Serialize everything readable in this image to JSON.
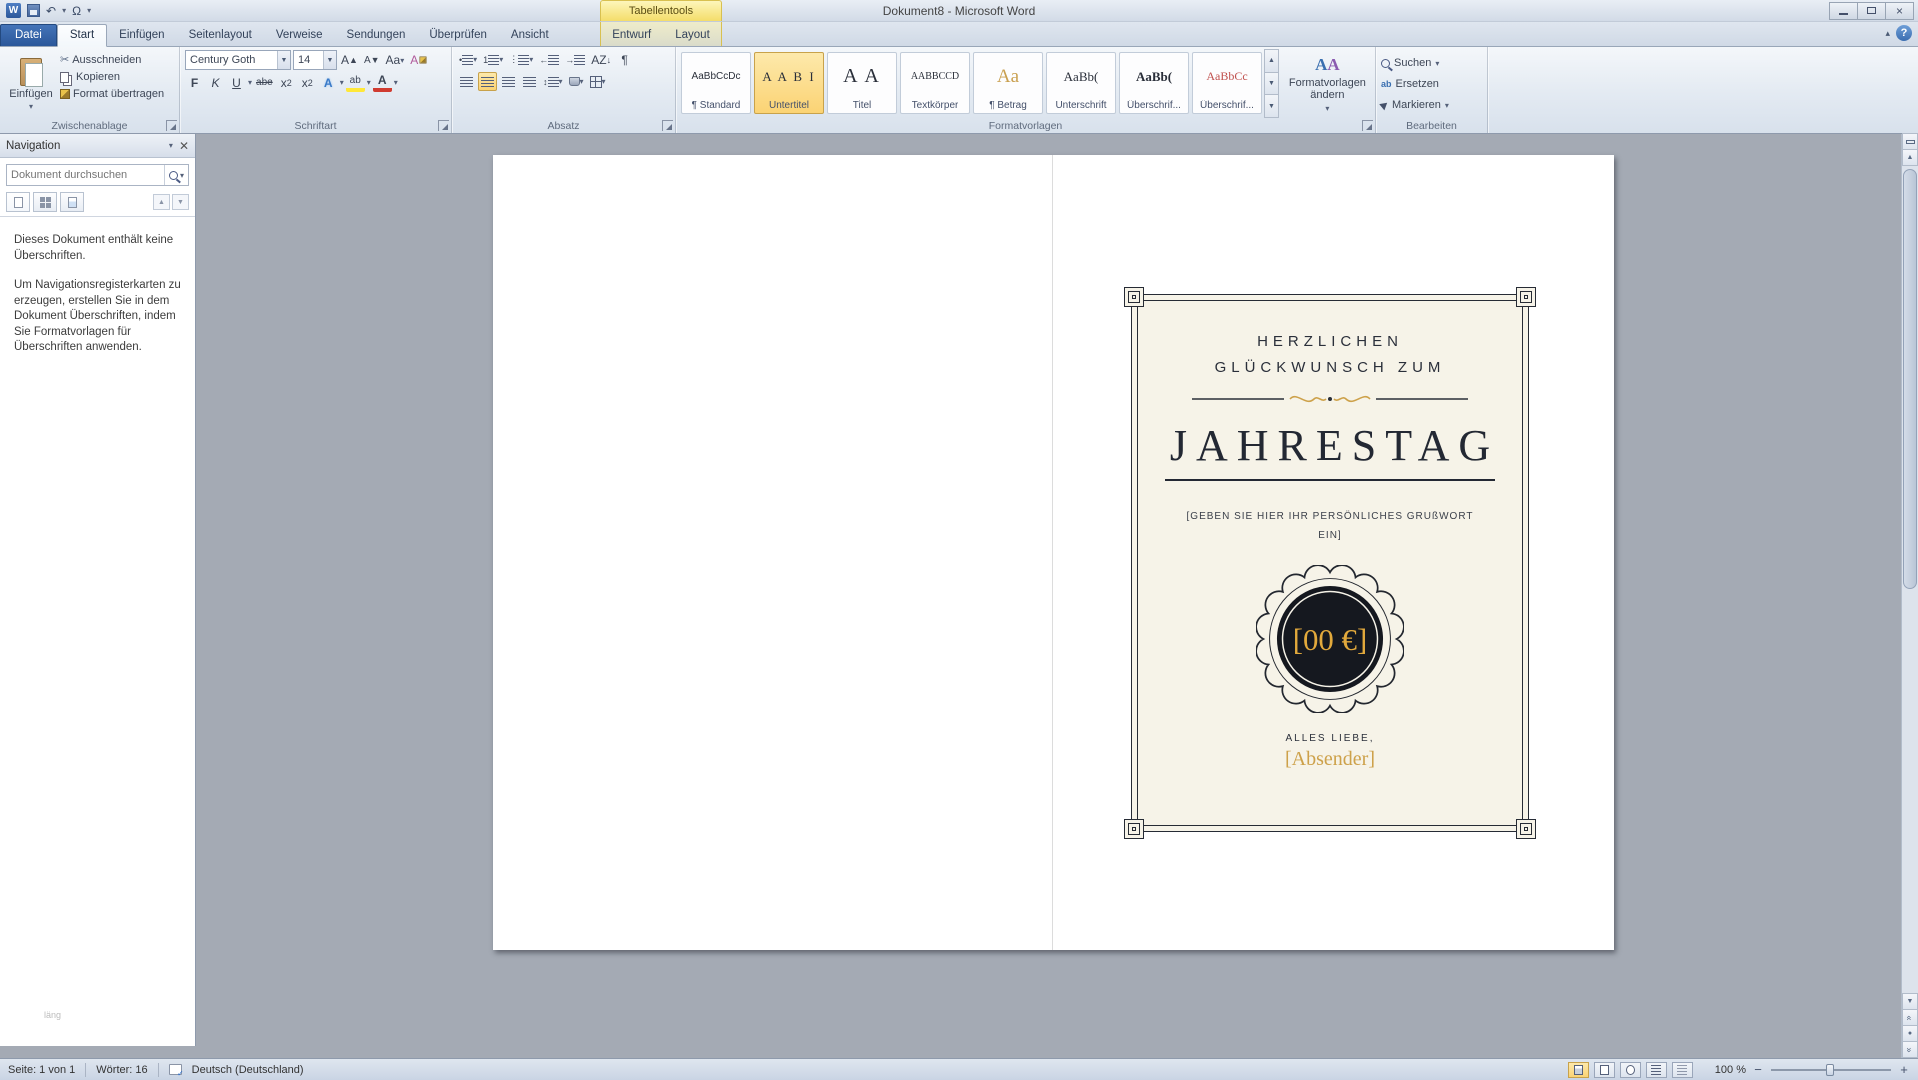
{
  "titlebar": {
    "title": "Dokument8 - Microsoft Word",
    "contextual_group": "Tabellentools"
  },
  "tabs": {
    "file": "Datei",
    "items": [
      "Start",
      "Einfügen",
      "Seitenlayout",
      "Verweise",
      "Sendungen",
      "Überprüfen",
      "Ansicht"
    ],
    "contextual": [
      "Entwurf",
      "Layout"
    ]
  },
  "ribbon": {
    "clipboard": {
      "group": "Zwischenablage",
      "paste": "Einfügen",
      "cut": "Ausschneiden",
      "copy": "Kopieren",
      "format_painter": "Format übertragen"
    },
    "font": {
      "group": "Schriftart",
      "font_name": "Century Goth",
      "font_size": "14",
      "bold": "F",
      "italic": "K",
      "underline": "U",
      "strike": "abe",
      "case": "Aa",
      "effects": "A",
      "highlight": "ab",
      "color": "A"
    },
    "paragraph": {
      "group": "Absatz",
      "sort": "AZ",
      "pilcrow": "¶"
    },
    "styles": {
      "group": "Formatvorlagen",
      "change_styles": "Formatvorlagen ändern",
      "items": [
        {
          "preview": "AaBbCcDc",
          "label": "¶ Standard"
        },
        {
          "preview": "A A B I",
          "label": "Untertitel"
        },
        {
          "preview": "A A",
          "label": "Titel"
        },
        {
          "preview": "AABBCCD",
          "label": "Textkörper"
        },
        {
          "preview": "Aa",
          "label": "¶ Betrag"
        },
        {
          "preview": "AaBb(",
          "label": "Unterschrift"
        },
        {
          "preview": "AaBb(",
          "label": "Überschrif..."
        },
        {
          "preview": "AaBbCc",
          "label": "Überschrif..."
        }
      ]
    },
    "editing": {
      "group": "Bearbeiten",
      "find": "Suchen",
      "replace": "Ersetzen",
      "select": "Markieren"
    }
  },
  "navigation": {
    "title": "Navigation",
    "search_placeholder": "Dokument durchsuchen",
    "empty_line1": "Dieses Dokument enthält keine Überschriften.",
    "empty_line2": "Um Navigationsregisterkarten zu erzeugen, erstellen Sie in dem Dokument Überschriften, indem Sie Formatvorlagen für Überschriften anwenden.",
    "footer_hint": "läng"
  },
  "document": {
    "card": {
      "heading_line1": "HERZLICHEN",
      "heading_line2": "GLÜCKWUNSCH ZUM",
      "title": "JAHRESTAG",
      "greeting_placeholder": "[GEBEN SIE HIER IHR PERSÖNLICHES GRUßWORT EIN]",
      "amount": "[00 €]",
      "closing": "ALLES LIEBE,",
      "sender": "[Absender]"
    }
  },
  "statusbar": {
    "page": "Seite: 1 von 1",
    "words": "Wörter: 16",
    "language": "Deutsch (Deutschland)",
    "zoom": "100 %"
  },
  "colors": {
    "accent_orange": "#fbd374",
    "gold": "#cda14a",
    "card_bg": "#f6f3e8",
    "card_ink": "#262b35"
  }
}
